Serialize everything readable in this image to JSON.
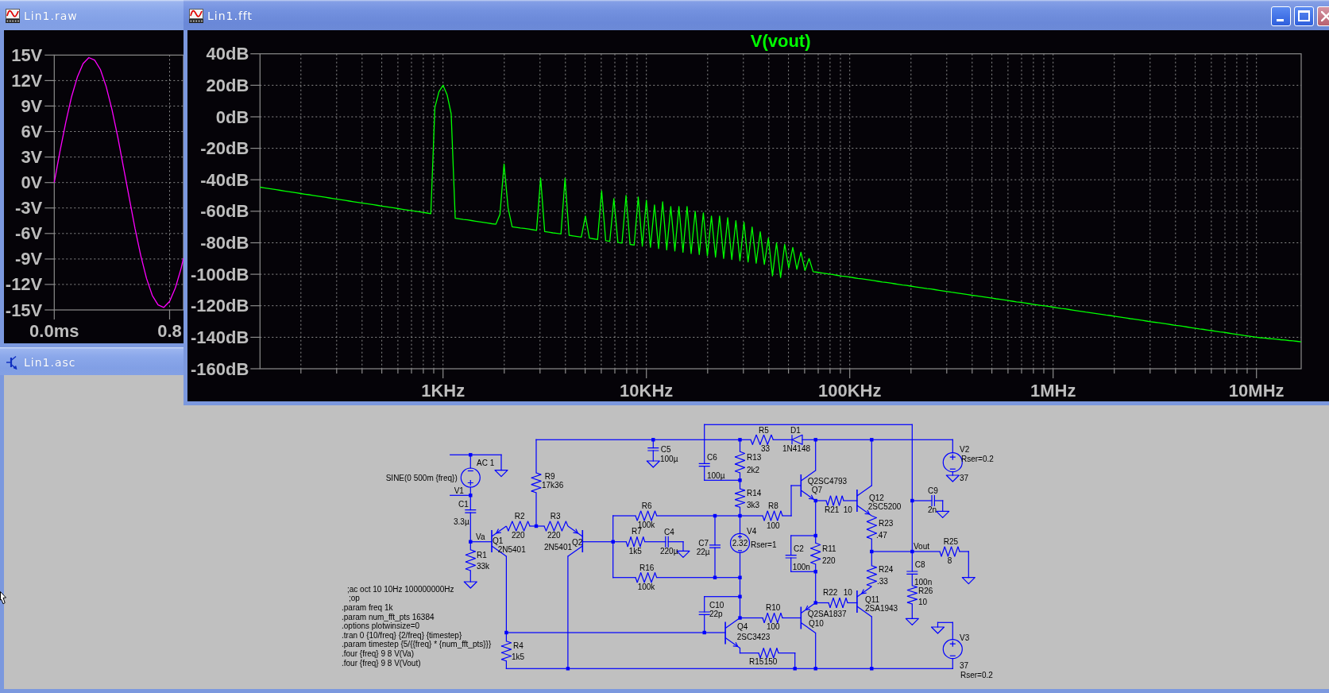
{
  "windows": [
    {
      "title": "Lin1.raw",
      "kind": "waveform",
      "active": false,
      "chart_data": {
        "type": "line",
        "grid": true,
        "x": [
          0,
          0.04,
          0.08,
          0.12,
          0.16,
          0.2,
          0.24,
          0.28,
          0.32,
          0.36,
          0.4,
          0.44,
          0.48,
          0.52,
          0.56,
          0.6,
          0.64,
          0.68,
          0.72,
          0.76,
          0.8,
          0.84,
          0.88,
          0.896
        ],
        "series": [
          {
            "color": "#ff00ff",
            "values": [
              0,
              3.7,
              7.1,
              10.1,
              12.4,
              14,
              14.7,
              14.4,
              13.3,
              11.3,
              8.6,
              5.4,
              1.8,
              -1.8,
              -5.4,
              -8.6,
              -11.3,
              -13.3,
              -14.4,
              -14.7,
              -14,
              -12.4,
              -10.1,
              -8.9
            ]
          }
        ],
        "xlim": [
          0,
          0.896
        ],
        "ylim": [
          -15,
          15
        ],
        "xticks": [
          {
            "value": 0,
            "label": "0.0ms"
          },
          {
            "value": 0.8,
            "label": "0.8"
          }
        ],
        "yticks": [
          {
            "value": 15,
            "label": "15V"
          },
          {
            "value": 12,
            "label": "12V"
          },
          {
            "value": 9,
            "label": "9V"
          },
          {
            "value": 6,
            "label": "6V"
          },
          {
            "value": 3,
            "label": "3V"
          },
          {
            "value": 0,
            "label": "0V"
          },
          {
            "value": -3,
            "label": "-3V"
          },
          {
            "value": -6,
            "label": "-6V"
          },
          {
            "value": -9,
            "label": "-9V"
          },
          {
            "value": -12,
            "label": "-12V"
          },
          {
            "value": -15,
            "label": "-15V"
          }
        ]
      }
    },
    {
      "title": "Lin1.fft",
      "kind": "waveform",
      "active": true,
      "chart_data": {
        "type": "line",
        "grid": true,
        "categories": [
          null,
          null,
          null,
          null,
          null,
          null,
          null,
          null,
          null,
          null,
          null,
          null,
          null,
          null,
          null,
          null,
          null,
          null,
          null,
          null,
          null,
          null,
          null,
          null,
          null,
          null,
          null,
          null,
          null,
          null,
          null,
          null,
          null,
          null,
          null,
          null,
          null,
          null,
          null,
          null,
          null,
          null,
          null,
          null,
          null,
          "1KHz",
          null,
          null,
          null,
          null,
          null,
          null,
          null,
          null,
          null,
          null,
          null,
          null,
          null,
          null,
          null,
          null,
          null,
          null,
          null,
          null,
          null,
          null,
          null,
          null,
          null,
          null,
          null,
          null,
          null,
          null,
          null,
          null,
          null,
          null,
          null,
          null,
          null,
          null,
          null,
          null,
          null,
          null,
          null,
          null,
          null,
          null,
          null,
          null,
          null,
          "10KHz",
          null,
          null,
          null,
          null,
          null,
          null,
          null,
          null,
          null,
          null,
          null,
          null,
          null,
          null,
          null,
          null,
          null,
          null,
          null,
          null,
          null,
          null,
          null,
          null,
          null,
          null,
          null,
          null,
          null,
          null,
          null,
          null,
          null,
          null,
          null,
          null,
          null,
          null,
          null,
          null,
          null,
          null,
          null,
          null,
          null,
          null,
          null,
          null,
          null,
          "100KHz",
          null,
          null,
          null,
          null,
          null,
          null,
          null,
          null,
          null,
          null,
          null,
          null,
          null,
          null,
          null,
          null,
          null,
          null,
          null,
          null,
          null,
          null,
          null,
          null,
          null,
          null,
          null,
          null,
          null,
          null,
          null,
          null,
          null,
          null,
          null,
          null,
          null,
          null,
          null,
          null,
          null,
          null,
          null,
          null,
          null,
          null,
          null,
          null,
          null,
          "1MHz",
          null,
          null,
          null,
          null,
          null,
          null,
          null,
          null,
          null,
          null,
          null,
          null,
          null,
          null,
          null,
          null,
          null,
          null,
          null,
          null,
          null,
          null,
          null,
          null,
          null,
          null,
          null,
          null,
          null,
          null,
          null,
          null,
          null,
          null,
          null,
          null,
          null,
          null,
          null,
          null,
          null,
          null,
          null,
          null,
          null,
          null,
          null,
          null,
          null,
          "10MHz",
          null,
          null,
          null,
          null,
          null,
          null,
          null,
          null,
          null,
          null,
          null
        ],
        "series": [
          {
            "name": "V(vout)",
            "color": "#00ff00",
            "values": [
              -44.7,
              -45.1,
              -45.5,
              -45.9,
              -46.3,
              -46.7,
              -47.1,
              -47.5,
              -47.9,
              -48.3,
              -48.7,
              -49.1,
              -49.5,
              -49.9,
              -50.3,
              -50.7,
              -51.1,
              -51.5,
              -51.9,
              -52.3,
              -52.7,
              -53.1,
              -53.5,
              -53.9,
              -54.3,
              -54.7,
              -55.1,
              -55.5,
              -55.9,
              -56.3,
              -56.7,
              -57.1,
              -57.5,
              -57.9,
              -58.3,
              -58.7,
              -59.1,
              -59.5,
              -59.9,
              -60.3,
              -60.7,
              -61.1,
              -61.5,
              6,
              16,
              20,
              14,
              2,
              -64.4,
              -64.8,
              -65.2,
              -65.5,
              -65.9,
              -66.3,
              -66.7,
              -67.1,
              -67.5,
              -67.9,
              -68.2,
              -62,
              -30,
              -58,
              -69.8,
              -70.2,
              -70.6,
              -70.9,
              -71.3,
              -71.7,
              -72.1,
              -39,
              -72.9,
              -73.3,
              -73.7,
              -74.0,
              -74.4,
              -39,
              -75.2,
              -75.6,
              -76.0,
              -76.4,
              -63,
              -77.1,
              -77.5,
              -77.9,
              -47,
              -78.7,
              -79.1,
              -52,
              -79.8,
              -80.2,
              -50,
              -81.0,
              -81.4,
              -51,
              -82.2,
              -53,
              -82.9,
              -56,
              -83.7,
              -54,
              -84.5,
              -57,
              -85.2,
              -57,
              -86.0,
              -57,
              -86.8,
              -60,
              -87.5,
              -61,
              -88.3,
              -63,
              -89.1,
              -63,
              -89.9,
              -64,
              -90.6,
              -66,
              -91.4,
              -67,
              -92.2,
              -70,
              -93.0,
              -73,
              -93.7,
              -77,
              -101,
              -80,
              -102,
              -81,
              -96.0,
              -83,
              -96.8,
              -86,
              -97.6,
              -90,
              -98.4,
              -98.7,
              -99.1,
              -99.5,
              -99.9,
              -100.3,
              -100.7,
              -101.1,
              -101.4,
              -101.8,
              -102.2,
              -102.6,
              -102.9,
              -103.3,
              -103.7,
              -104.1,
              -104.5,
              -104.9,
              -105.2,
              -105.6,
              -106.0,
              -106.4,
              -106.8,
              -107.1,
              -107.5,
              -107.9,
              -108.3,
              -108.7,
              -109.1,
              -109.4,
              -109.8,
              -110.2,
              -110.6,
              -111.0,
              -111.4,
              -111.7,
              -112.1,
              -112.5,
              -112.9,
              -113.3,
              -113.6,
              -114.0,
              -114.4,
              -114.8,
              -115.2,
              -115.6,
              -115.9,
              -116.3,
              -116.7,
              -117.1,
              -117.5,
              -117.8,
              -118.2,
              -118.6,
              -119.0,
              -119.4,
              -119.8,
              -120.1,
              -120.5,
              -120.9,
              -121.3,
              -121.7,
              -122.0,
              -122.4,
              -122.8,
              -123.2,
              -123.6,
              -124.0,
              -124.3,
              -124.7,
              -125.1,
              -125.5,
              -125.9,
              -126.2,
              -126.6,
              -127.0,
              -127.4,
              -127.8,
              -128.2,
              -128.5,
              -128.9,
              -129.3,
              -129.7,
              -130.1,
              -130.5,
              -130.8,
              -131.2,
              -131.6,
              -132.0,
              -132.4,
              -132.7,
              -133.1,
              -133.5,
              -133.9,
              -134.3,
              -134.7,
              -135.0,
              -135.4,
              -135.8,
              -136.2,
              -136.6,
              -136.9,
              -137.3,
              -137.7,
              -138.1,
              -138.5,
              -138.9,
              -139.2,
              -139.6,
              -140.0,
              -140.3,
              -140.5,
              -140.8,
              -141.0,
              -141.3,
              -141.6,
              -141.8,
              -142.1,
              -142.3,
              -142.6,
              -142.9
            ]
          }
        ],
        "ylim": [
          -160,
          40
        ],
        "yticks": [
          {
            "value": 40,
            "label": "40dB"
          },
          {
            "value": 20,
            "label": "20dB"
          },
          {
            "value": 0,
            "label": "0dB"
          },
          {
            "value": -20,
            "label": "-20dB"
          },
          {
            "value": -40,
            "label": "-40dB"
          },
          {
            "value": -60,
            "label": "-60dB"
          },
          {
            "value": -80,
            "label": "-80dB"
          },
          {
            "value": -100,
            "label": "-100dB"
          },
          {
            "value": -120,
            "label": "-120dB"
          },
          {
            "value": -140,
            "label": "-140dB"
          },
          {
            "value": -160,
            "label": "-160dB"
          }
        ]
      }
    },
    {
      "title": "Lin1.asc",
      "kind": "schematic",
      "active": false,
      "schematic": {
        "components": [
          {
            "kind": "voltage_source",
            "ref": "V1",
            "value": "SINE(0 500m {freq})",
            "spec": "AC 1"
          },
          {
            "kind": "capacitor",
            "ref": "C1",
            "value": "3.3µ"
          },
          {
            "kind": "resistor",
            "ref": "R9",
            "value": "17k36"
          },
          {
            "kind": "resistor",
            "ref": "R2",
            "value": "220"
          },
          {
            "kind": "resistor",
            "ref": "R1",
            "value": "33k"
          },
          {
            "kind": "pnp",
            "ref": "Q1",
            "value": "2N5401"
          },
          {
            "kind": "resistor",
            "ref": "R3",
            "value": "220"
          },
          {
            "kind": "pnp",
            "ref": "Q2",
            "value": "2N5401"
          },
          {
            "kind": "resistor",
            "ref": "R4",
            "value": "1k5"
          },
          {
            "kind": "capacitor",
            "ref": "C5",
            "value": "100µ"
          },
          {
            "kind": "capacitor",
            "ref": "C6",
            "value": "100µ"
          },
          {
            "kind": "resistor",
            "ref": "R6",
            "value": "100k"
          },
          {
            "kind": "resistor",
            "ref": "R7",
            "value": "1k5"
          },
          {
            "kind": "capacitor",
            "ref": "C4",
            "value": "220µ"
          },
          {
            "kind": "resistor",
            "ref": "R16",
            "value": "100k"
          },
          {
            "kind": "capacitor",
            "ref": "C7",
            "value": "22µ"
          },
          {
            "kind": "resistor",
            "ref": "R5",
            "value": "33"
          },
          {
            "kind": "resistor",
            "ref": "R13",
            "value": "2k2"
          },
          {
            "kind": "resistor",
            "ref": "R14",
            "value": "3k3"
          },
          {
            "kind": "diode",
            "ref": "D1",
            "value": "1N4148"
          },
          {
            "kind": "resistor",
            "ref": "R8",
            "value": "100"
          },
          {
            "kind": "voltage_source",
            "ref": "V4",
            "value": "2.32",
            "spec": "Rser=1"
          },
          {
            "kind": "capacitor",
            "ref": "C10",
            "value": "22p"
          },
          {
            "kind": "resistor",
            "ref": "R10",
            "value": "100"
          },
          {
            "kind": "npn",
            "ref": "Q4",
            "value": "2SC3423"
          },
          {
            "kind": "resistor",
            "ref": "R15",
            "value": "150"
          },
          {
            "kind": "npn",
            "ref": "Q7",
            "value": "Q2SC4793"
          },
          {
            "kind": "resistor",
            "ref": "R21",
            "value": "10"
          },
          {
            "kind": "capacitor",
            "ref": "C2",
            "value": "100n"
          },
          {
            "kind": "resistor",
            "ref": "R11",
            "value": "220"
          },
          {
            "kind": "resistor",
            "ref": "R22",
            "value": "10"
          },
          {
            "kind": "pnp",
            "ref": "Q10",
            "value": "Q2SA1837"
          },
          {
            "kind": "npn",
            "ref": "Q12",
            "value": "2SC5200"
          },
          {
            "kind": "resistor",
            "ref": "R23",
            "value": ".47"
          },
          {
            "kind": "resistor",
            "ref": "R24",
            "value": ".33"
          },
          {
            "kind": "pnp",
            "ref": "Q11",
            "value": "2SA1943"
          },
          {
            "kind": "voltage_source",
            "ref": "V2",
            "value": "37",
            "spec": "Rser=0.2"
          },
          {
            "kind": "capacitor",
            "ref": "C9",
            "value": "2n"
          },
          {
            "kind": "capacitor",
            "ref": "C8",
            "value": "100n"
          },
          {
            "kind": "resistor",
            "ref": "R25",
            "value": "8"
          },
          {
            "kind": "resistor",
            "ref": "R26",
            "value": "10"
          },
          {
            "kind": "voltage_source",
            "ref": "V3",
            "value": "37",
            "spec": "Rser=0.2"
          }
        ],
        "net_labels": [
          "Va",
          "Vout"
        ],
        "directives": [
          ";ac oct 10 10Hz 100000000Hz",
          ";op",
          ".param freq 1k",
          ".param num_fft_pts 16384",
          ".options plotwinsize=0",
          ".tran 0 {10/freq} {2/freq} {timestep}",
          ".param timestep {5/{{freq} * {num_fft_pts}}}",
          ".four {freq} 9 8 V(Va)",
          ".four {freq} 9 8 V(Vout)"
        ]
      }
    }
  ]
}
